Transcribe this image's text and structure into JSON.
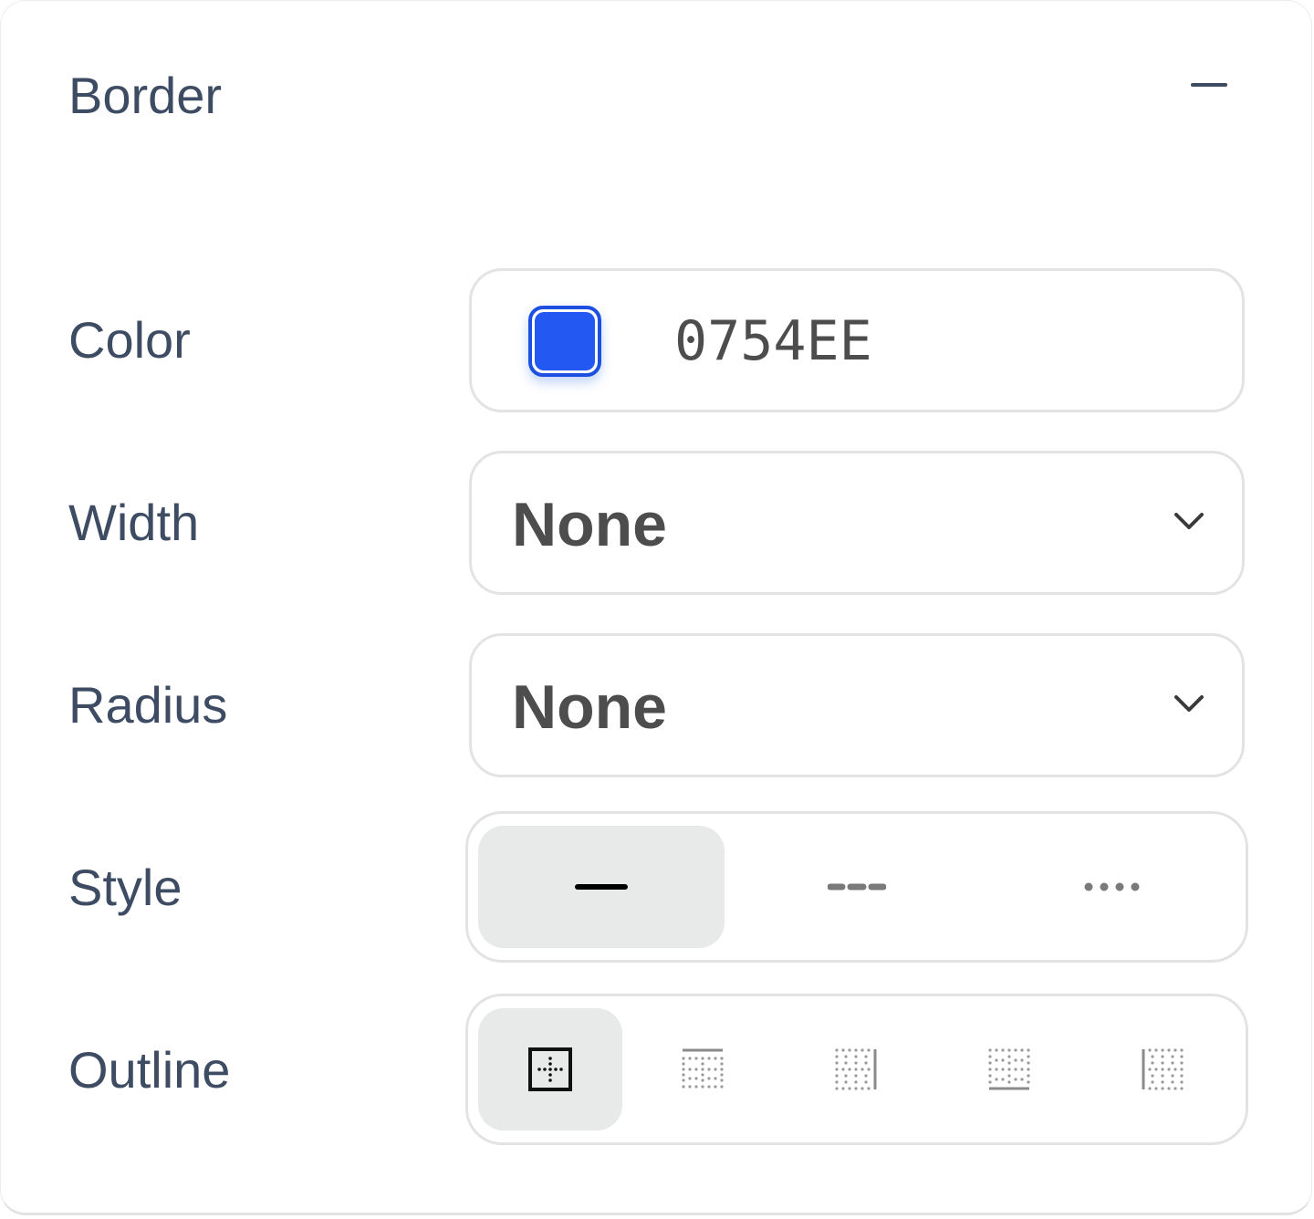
{
  "header": {
    "title": "Border"
  },
  "rows": {
    "color": {
      "label": "Color",
      "hex_value": "0754EE",
      "swatch_color": "#0754EE"
    },
    "width": {
      "label": "Width",
      "value": "None"
    },
    "radius": {
      "label": "Radius",
      "value": "None"
    },
    "style": {
      "label": "Style",
      "options": [
        "solid-line-icon",
        "dashed-line-icon",
        "dotted-line-icon"
      ],
      "selected": "solid-line-icon"
    },
    "outline": {
      "label": "Outline",
      "options": [
        "border-all-icon",
        "border-top-icon",
        "border-right-icon",
        "border-bottom-icon",
        "border-left-icon"
      ],
      "selected": "border-all-icon"
    }
  }
}
